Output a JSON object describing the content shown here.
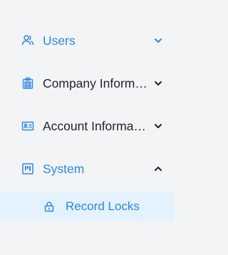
{
  "sidebar": {
    "items": [
      {
        "label": "Users",
        "icon": "users-icon",
        "chevron": "chevron-down-icon",
        "active_color": "#2f87e4"
      },
      {
        "label": "Company Inform…",
        "icon": "company-icon",
        "chevron": "chevron-down-icon"
      },
      {
        "label": "Account Informa…",
        "icon": "account-card-icon",
        "chevron": "chevron-down-icon"
      },
      {
        "label": "System",
        "icon": "system-icon",
        "chevron": "chevron-up-icon",
        "active_color": "#2f87e4",
        "children": [
          {
            "label": "Record Locks",
            "icon": "lock-icon",
            "selected": true,
            "highlight_color": "#e3f2fc"
          }
        ]
      }
    ]
  },
  "colors": {
    "accent": "#2f87e4",
    "text": "#1f2328",
    "background": "#f3f4f6",
    "selected_background": "#e3f2fc"
  }
}
